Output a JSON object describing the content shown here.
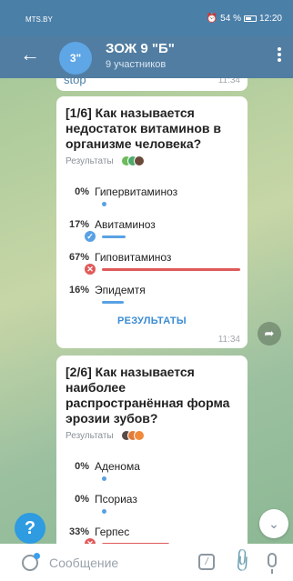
{
  "status_bar": {
    "carrier": "MTS.BY",
    "battery": "54 %",
    "time": "12:20"
  },
  "header": {
    "back_icon": "arrow-left-icon",
    "avatar_text": "3\"",
    "title": "ЗОЖ 9 \"Б\"",
    "subtitle": "9 участников",
    "menu_icon": "more-vertical-icon"
  },
  "messages": {
    "top": {
      "text": "stop",
      "time": "11:34"
    },
    "poll1": {
      "question": "[1/6] Как называется недостаток витаминов в организме человека?",
      "results_label": "Результаты",
      "options": [
        {
          "percent": "0%",
          "label": "Гипервитаминоз",
          "value": 0,
          "status": "none"
        },
        {
          "percent": "17%",
          "label": "Авитаминоз",
          "value": 17,
          "status": "correct"
        },
        {
          "percent": "67%",
          "label": "Гиповитаминоз",
          "value": 67,
          "status": "wrong"
        },
        {
          "percent": "16%",
          "label": "Эпидемтя",
          "value": 16,
          "status": "none"
        }
      ],
      "results_button": "РЕЗУЛЬТАТЫ",
      "time": "11:34"
    },
    "poll2": {
      "question": "[2/6] Как называется наиболее распространённая форма эрозии зубов?",
      "results_label": "Результаты",
      "options": [
        {
          "percent": "0%",
          "label": "Аденома",
          "value": 0,
          "status": "none"
        },
        {
          "percent": "0%",
          "label": "Псориаз",
          "value": 0,
          "status": "none"
        },
        {
          "percent": "33%",
          "label": "Герпес",
          "value": 33,
          "status": "wrong"
        }
      ]
    }
  },
  "colors": {
    "correct": "#59a1e3",
    "wrong": "#e05a5a",
    "accent": "#517da2"
  },
  "input": {
    "placeholder": "Сообщение"
  }
}
